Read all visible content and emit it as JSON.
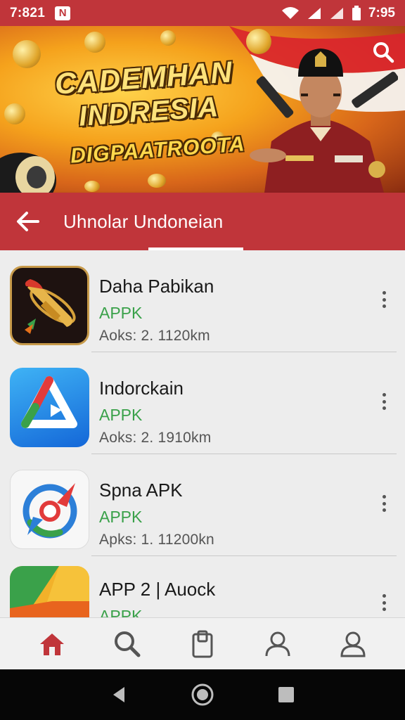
{
  "status_bar": {
    "time_left": "7:821",
    "notif_letter": "N",
    "time_right": "7:95"
  },
  "banner": {
    "line1": "CADEMHAN",
    "line2": "INDRESIA",
    "line3": "DIGPAATROOTA"
  },
  "appbar": {
    "title": "Uhnolar Undoneian"
  },
  "apps": [
    {
      "name": "Daha Pabikan",
      "type": "APPK",
      "meta": "Aoks: 2. 1120km",
      "icon": "bullet-coin-icon"
    },
    {
      "name": "Indorckain",
      "type": "APPK",
      "meta": "Aoks: 2. 1910km",
      "icon": "play-triangle-icon"
    },
    {
      "name": "Spna APK",
      "type": "APPK",
      "meta": "Apks: 1. 11200kn",
      "icon": "compass-icon"
    },
    {
      "name": "APP 2 | Auock",
      "type": "APPK",
      "meta": "",
      "icon": "folder-icon"
    }
  ],
  "bottom_nav": [
    "home-icon",
    "search-icon",
    "clipboard-icon",
    "profile-icon",
    "account-icon"
  ],
  "colors": {
    "brand_red": "#c0353a",
    "apk_green": "#3aa14a",
    "home_active": "#c0353a"
  }
}
